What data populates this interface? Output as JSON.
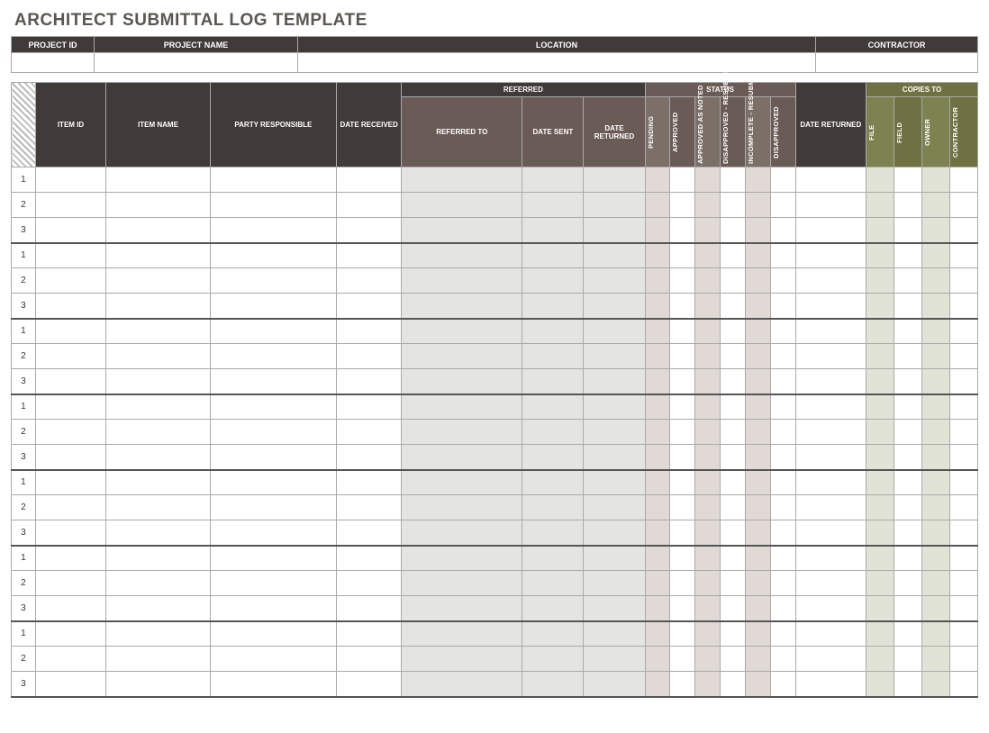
{
  "title": "ARCHITECT SUBMITTAL LOG TEMPLATE",
  "info_headers": {
    "project_id": "PROJECT ID",
    "project_name": "PROJECT NAME",
    "location": "LOCATION",
    "contractor": "CONTRACTOR"
  },
  "info_values": {
    "project_id": "",
    "project_name": "",
    "location": "",
    "contractor": ""
  },
  "columns": {
    "item_id": "ITEM ID",
    "item_name": "ITEM NAME",
    "party_responsible": "PARTY RESPONSIBLE",
    "date_received": "DATE RECEIVED",
    "referred_group": "REFERRED",
    "referred_to": "REFERRED TO",
    "date_sent": "DATE SENT",
    "date_returned": "DATE RETURNED",
    "status_group": "STATUS",
    "status": {
      "pending": "PENDING",
      "approved": "APPROVED",
      "approved_as_noted": "APPROVED AS NOTED",
      "disapproved_resubmit": "DISAPPROVED - RESUBMIT",
      "incomplete_resubmit": "INCOMPLETE - RESUBMIT",
      "disapproved": "DISAPPROVED"
    },
    "date_returned2": "DATE RETURNED",
    "copies_group": "COPIES TO",
    "copies": {
      "file": "FILE",
      "field": "FIELD",
      "owner": "OWNER",
      "contractor": "CONTRACTOR"
    }
  },
  "row_groups": 7,
  "rows_per_group": 3
}
